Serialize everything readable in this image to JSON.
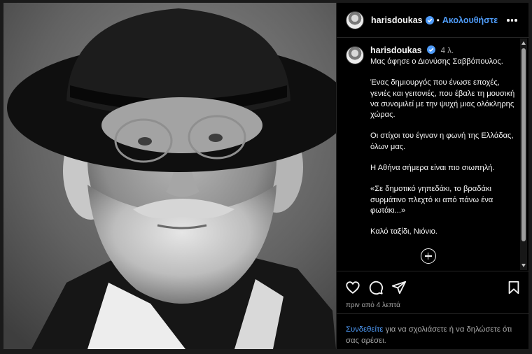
{
  "header": {
    "username": "harisdoukas",
    "follow_label": "Ακολουθήστε"
  },
  "caption": {
    "username": "harisdoukas",
    "time": "4 λ.",
    "paragraphs": [
      "Μας άφησε ο Διονύσης Σαββόπουλος.",
      "Ένας δημιουργός που ένωσε εποχές, γενιές και γειτονιές, που έβαλε τη μουσική να συνομιλεί με την ψυχή μιας ολόκληρης χώρας.",
      "Οι στίχοι του έγιναν η φωνή της Ελλάδας, όλων μας.",
      "Η Αθήνα σήμερα είναι πιο σιωπηλή.",
      "«Σε δημοτικό γηπεδάκι, το βραδάκι συρμάτινο πλεχτό κι από πάνω ένα φωτάκι...»",
      "Καλό ταξίδι, Νιόνιο."
    ]
  },
  "actions": {
    "timestamp": "πριν από 4 λεπτά"
  },
  "login": {
    "link_label": "Συνδεθείτε",
    "rest_text": " για να σχολιάσετε ή να δηλώσετε ότι σας αρέσει."
  },
  "colors": {
    "accent": "#4f9cf9",
    "panel_bg": "#000000"
  },
  "icons": {
    "verified": "verified-badge-icon",
    "more": "more-options-icon",
    "like": "heart-icon",
    "comment": "comment-icon",
    "share": "paper-plane-icon",
    "save": "bookmark-icon",
    "load_more": "plus-circle-icon"
  }
}
